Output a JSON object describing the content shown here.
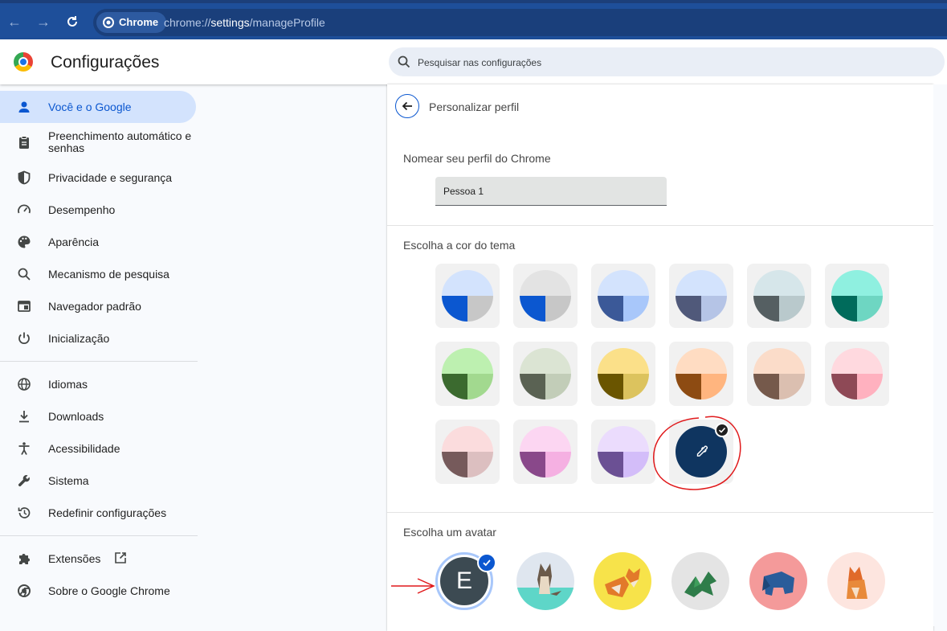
{
  "browser": {
    "chip_label": "Chrome",
    "url_scheme": "chrome://",
    "url_host": "settings",
    "url_path": "/manageProfile"
  },
  "header": {
    "title": "Configurações",
    "search_placeholder": "Pesquisar nas configurações"
  },
  "sidebar": {
    "items": [
      {
        "label": "Você e o Google",
        "icon": "person-icon",
        "active": true
      },
      {
        "label": "Preenchimento automático e senhas",
        "icon": "clipboard-icon"
      },
      {
        "label": "Privacidade e segurança",
        "icon": "shield-icon"
      },
      {
        "label": "Desempenho",
        "icon": "speedometer-icon"
      },
      {
        "label": "Aparência",
        "icon": "palette-icon"
      },
      {
        "label": "Mecanismo de pesquisa",
        "icon": "search-icon"
      },
      {
        "label": "Navegador padrão",
        "icon": "browser-window-icon"
      },
      {
        "label": "Inicialização",
        "icon": "power-icon"
      },
      {
        "label": "Idiomas",
        "icon": "globe-icon"
      },
      {
        "label": "Downloads",
        "icon": "download-icon"
      },
      {
        "label": "Acessibilidade",
        "icon": "accessibility-icon"
      },
      {
        "label": "Sistema",
        "icon": "wrench-icon"
      },
      {
        "label": "Redefinir configurações",
        "icon": "history-icon"
      },
      {
        "label": "Extensões",
        "icon": "puzzle-icon"
      },
      {
        "label": "Sobre o Google Chrome",
        "icon": "chrome-icon"
      }
    ]
  },
  "main": {
    "title": "Personalizar perfil",
    "name_section_label": "Nomear seu perfil do Chrome",
    "profile_name": "Pessoa 1",
    "theme_section_label": "Escolha a cor do tema",
    "avatar_section_label": "Escolha um avatar",
    "avatar_letter": "E",
    "theme_colors": [
      {
        "top": "#d3e3fd",
        "left": "#0b57d0",
        "right": "#c7c7c7"
      },
      {
        "top": "#e3e3e3",
        "left": "#0b57d0",
        "right": "#c7c7c7"
      },
      {
        "top": "#d3e3fd",
        "left": "#3b5998",
        "right": "#a8c7fa"
      },
      {
        "top": "#d3e3fd",
        "left": "#50597a",
        "right": "#b5c4e6"
      },
      {
        "top": "#d6e6ea",
        "left": "#555f62",
        "right": "#b9c9cc"
      },
      {
        "top": "#8ff0e0",
        "left": "#006b5b",
        "right": "#6ed6c2"
      },
      {
        "top": "#bdf0b0",
        "left": "#3b6a2f",
        "right": "#a2d98f"
      },
      {
        "top": "#dbe4d3",
        "left": "#5a6253",
        "right": "#c2cdb8"
      },
      {
        "top": "#fbe089",
        "left": "#6a5500",
        "right": "#dcc35e"
      },
      {
        "top": "#ffdcc2",
        "left": "#8d4b12",
        "right": "#ffb57f"
      },
      {
        "top": "#fbdcc9",
        "left": "#75594b",
        "right": "#dbbfb0"
      },
      {
        "top": "#ffd9df",
        "left": "#8e4956",
        "right": "#ffb1bf"
      },
      {
        "top": "#fbdcdd",
        "left": "#765a5b",
        "right": "#dcbfc0"
      },
      {
        "top": "#fcd6f2",
        "left": "#89488a",
        "right": "#f5b0e2"
      },
      {
        "top": "#ebdcfd",
        "left": "#6b5094",
        "right": "#d3bdf9"
      }
    ],
    "custom_color": "#0f3560"
  }
}
